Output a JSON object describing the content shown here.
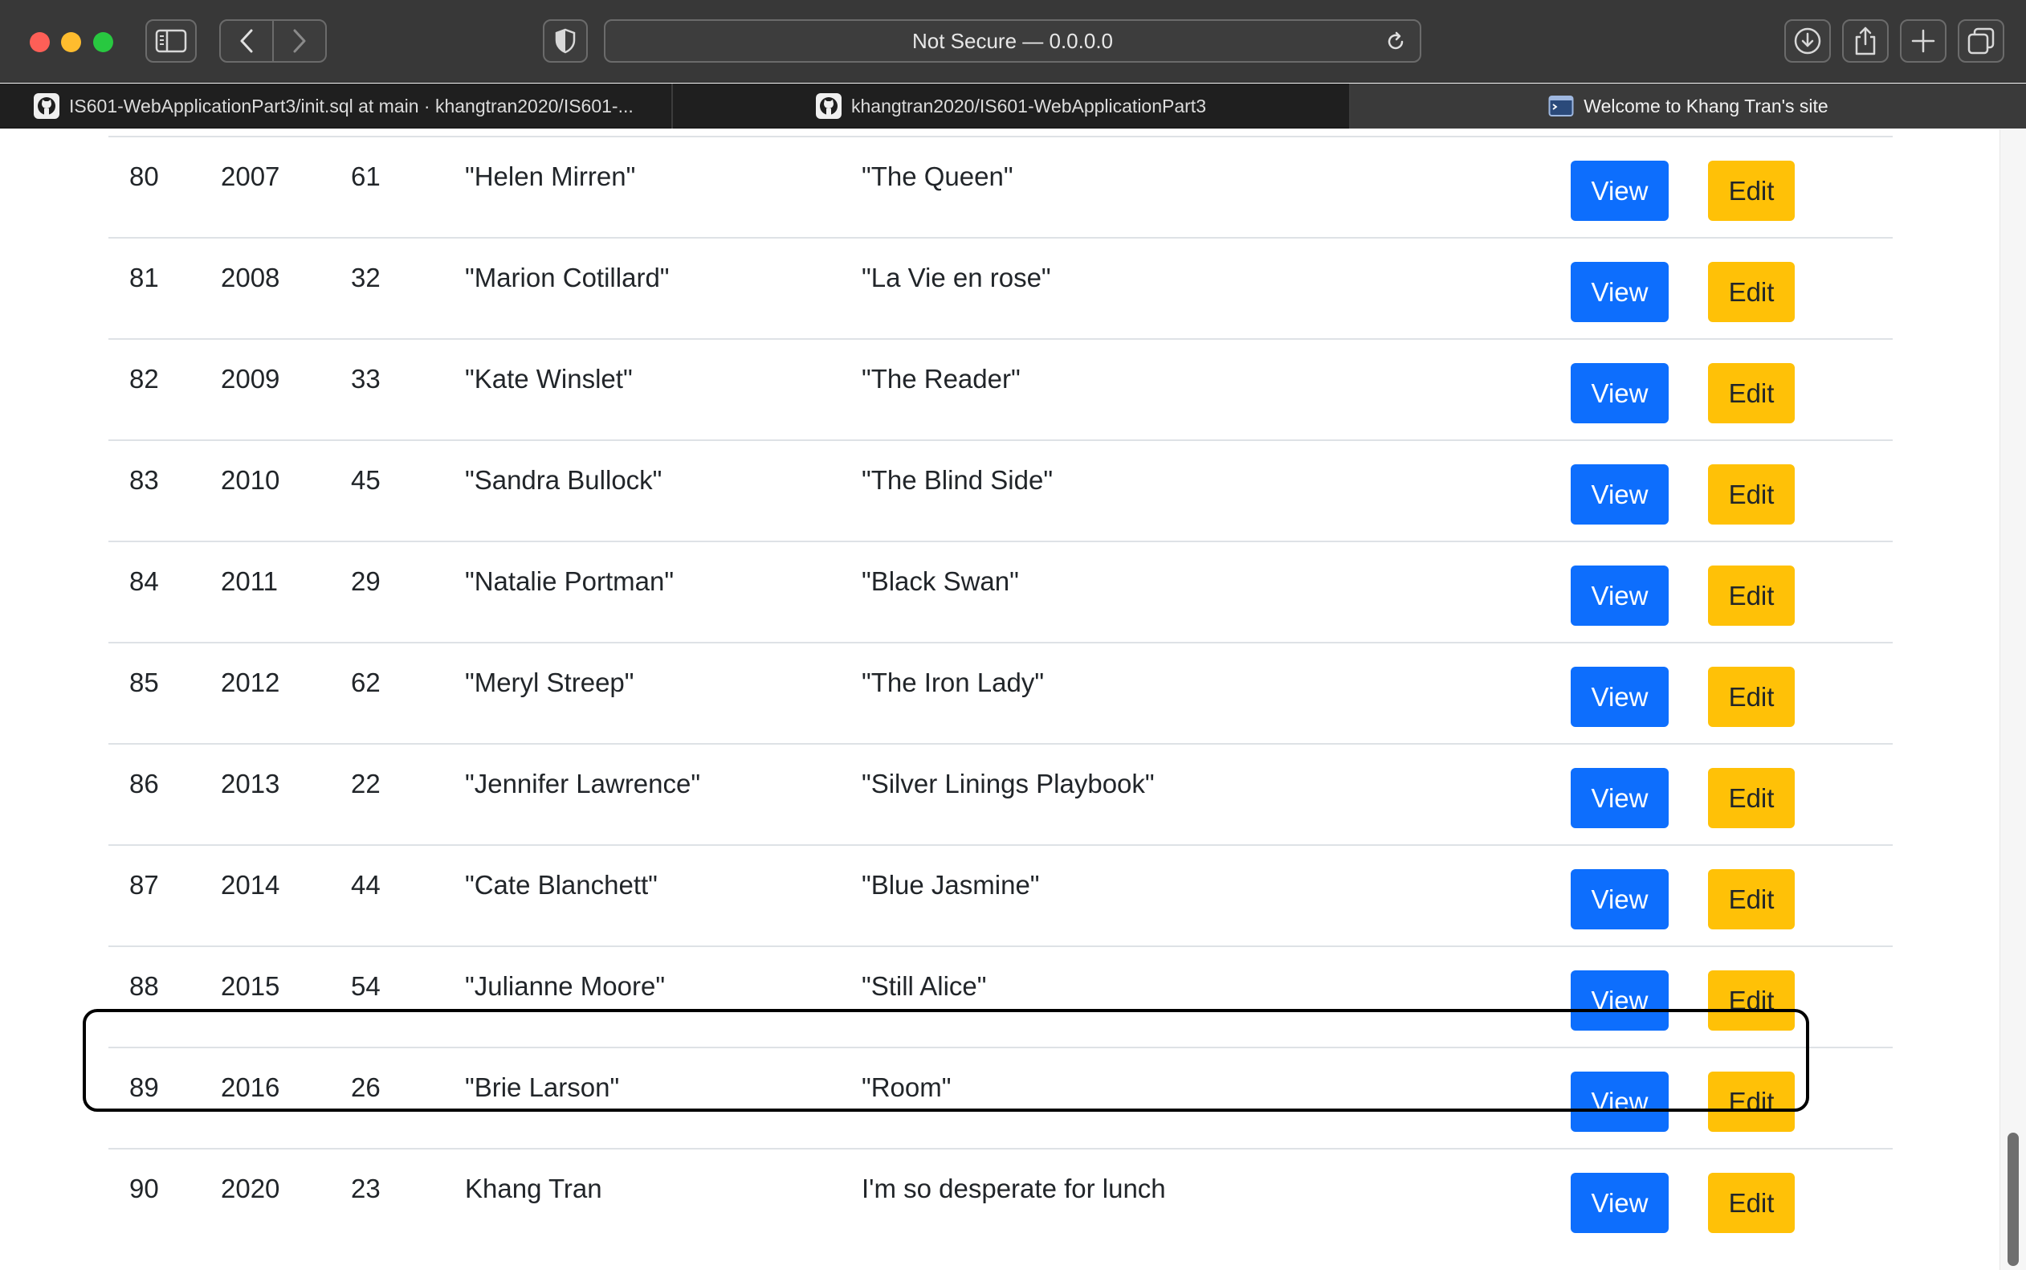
{
  "browser": {
    "address": "Not Secure — 0.0.0.0",
    "tabs": [
      {
        "title": "IS601-WebApplicationPart3/init.sql at main · khangtran2020/IS601-...",
        "icon": "github-icon"
      },
      {
        "title": "khangtran2020/IS601-WebApplicationPart3",
        "icon": "github-icon"
      },
      {
        "title": "Welcome to Khang Tran's site",
        "icon": "terminal-icon",
        "active": true
      }
    ]
  },
  "table": {
    "view_label": "View",
    "edit_label": "Edit",
    "rows": [
      {
        "id": "80",
        "year": "2007",
        "age": "61",
        "name": "\"Helen Mirren\"",
        "movie": "\"The Queen\""
      },
      {
        "id": "81",
        "year": "2008",
        "age": "32",
        "name": "\"Marion Cotillard\"",
        "movie": "\"La Vie en rose\""
      },
      {
        "id": "82",
        "year": "2009",
        "age": "33",
        "name": "\"Kate Winslet\"",
        "movie": "\"The Reader\""
      },
      {
        "id": "83",
        "year": "2010",
        "age": "45",
        "name": "\"Sandra Bullock\"",
        "movie": "\"The Blind Side\""
      },
      {
        "id": "84",
        "year": "2011",
        "age": "29",
        "name": "\"Natalie Portman\"",
        "movie": "\"Black Swan\""
      },
      {
        "id": "85",
        "year": "2012",
        "age": "62",
        "name": "\"Meryl Streep\"",
        "movie": "\"The Iron Lady\""
      },
      {
        "id": "86",
        "year": "2013",
        "age": "22",
        "name": "\"Jennifer Lawrence\"",
        "movie": "\"Silver Linings Playbook\""
      },
      {
        "id": "87",
        "year": "2014",
        "age": "44",
        "name": "\"Cate Blanchett\"",
        "movie": "\"Blue Jasmine\""
      },
      {
        "id": "88",
        "year": "2015",
        "age": "54",
        "name": "\"Julianne Moore\"",
        "movie": "\"Still Alice\""
      },
      {
        "id": "89",
        "year": "2016",
        "age": "26",
        "name": "\"Brie Larson\"",
        "movie": "\"Room\""
      },
      {
        "id": "90",
        "year": "2020",
        "age": "23",
        "name": "Khang Tran",
        "movie": "I'm so desperate for lunch"
      }
    ]
  },
  "colors": {
    "view_button": "#0d6efd",
    "edit_button": "#ffc107",
    "chrome": "#383838",
    "tabbar": "#1f1f1f"
  }
}
